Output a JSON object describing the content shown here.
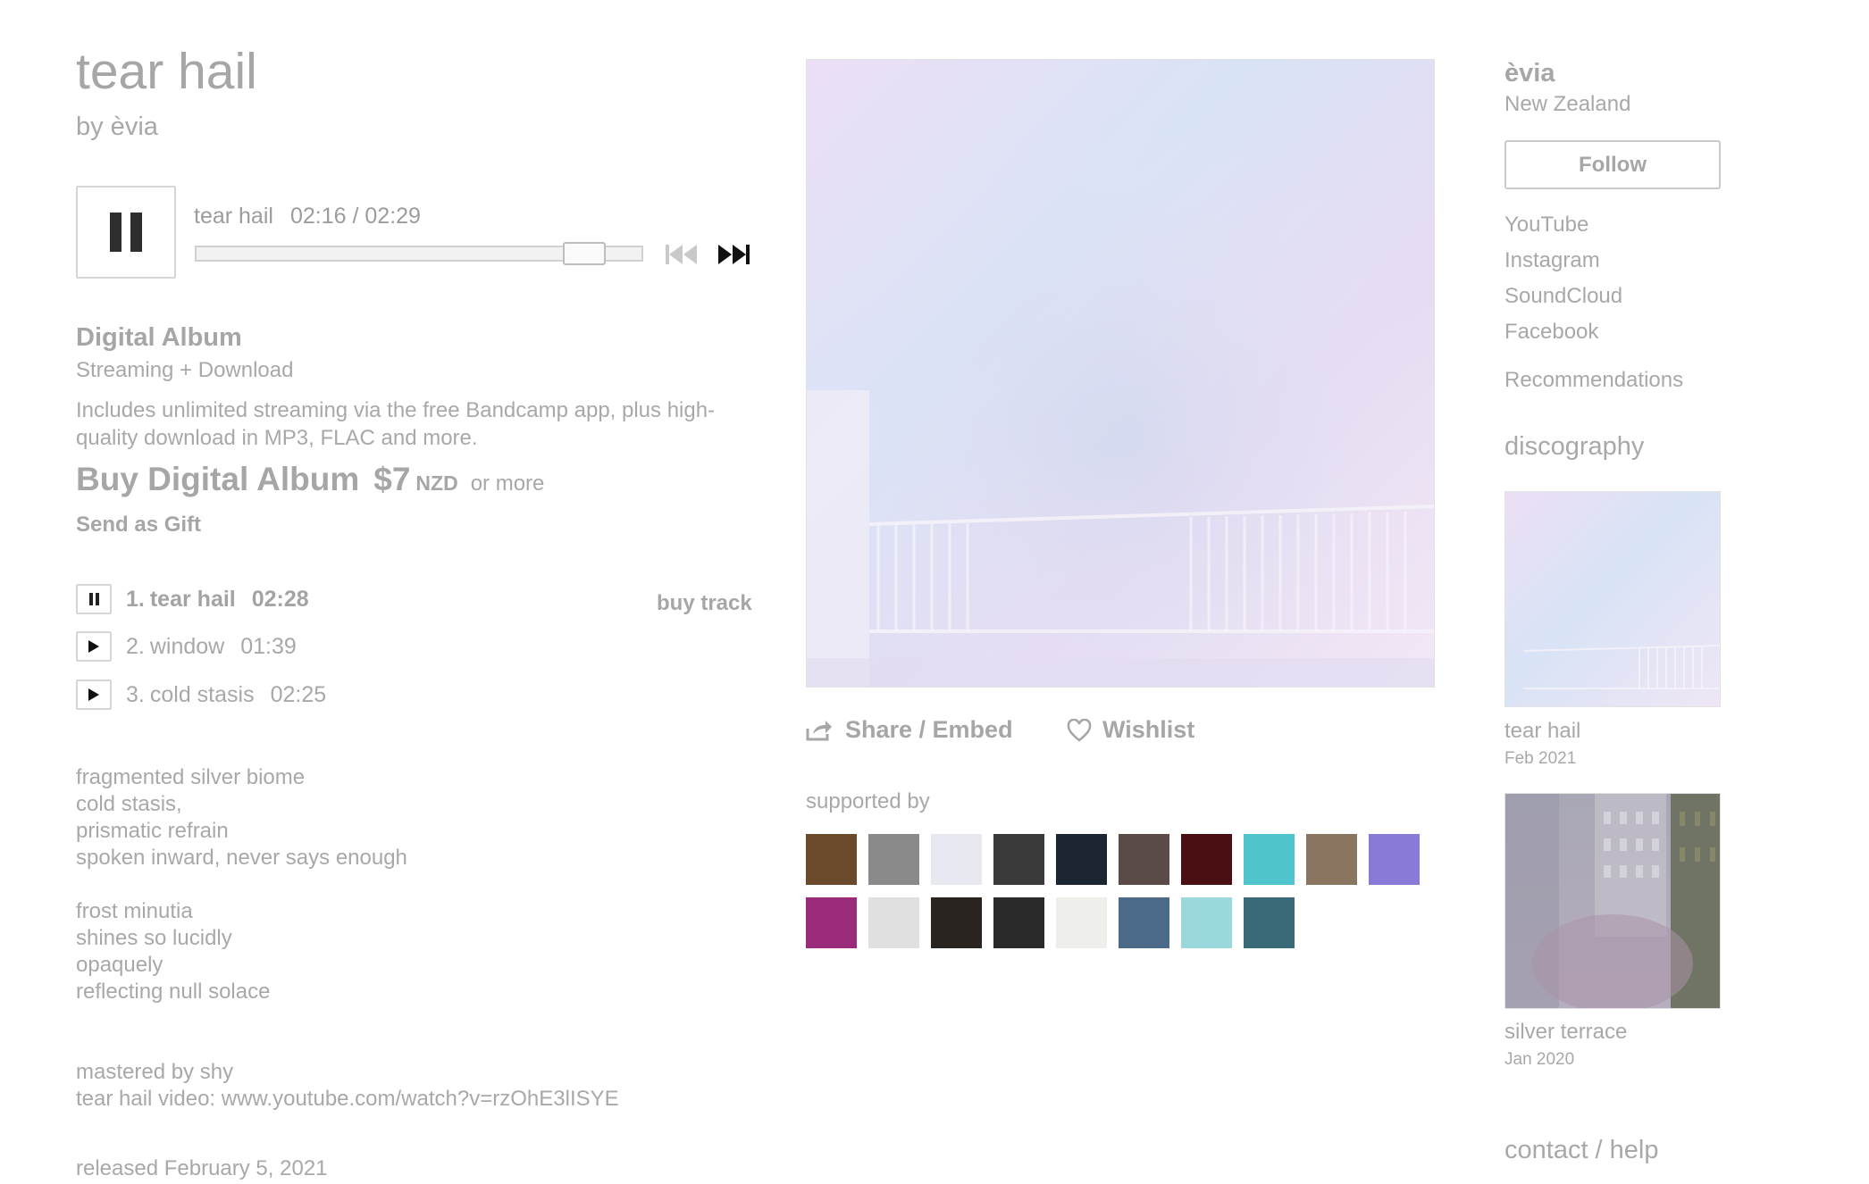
{
  "album": {
    "title": "tear hail",
    "by": "by èvia"
  },
  "player": {
    "track_title": "tear hail",
    "time": "02:16 / 02:29",
    "progress": 0.91
  },
  "purchase": {
    "format": "Digital Album",
    "streaming": "Streaming + Download",
    "description": "Includes unlimited streaming via the free Bandcamp app, plus high-quality download in MP3, FLAC and more.",
    "buy_label": "Buy Digital Album",
    "price": "$7",
    "currency": "NZD",
    "or_more": "or more",
    "gift": "Send as Gift"
  },
  "tracks": [
    {
      "number": "1.",
      "title": "tear hail",
      "duration": "02:28",
      "state": "playing"
    },
    {
      "number": "2.",
      "title": "window",
      "duration": "01:39",
      "state": "stopped"
    },
    {
      "number": "3.",
      "title": "cold stasis",
      "duration": "02:25",
      "state": "stopped"
    }
  ],
  "buy_track": "buy track",
  "lyrics": [
    "fragmented silver biome",
    "cold stasis,",
    "prismatic refrain",
    "spoken inward, never says enough",
    "frost minutia",
    "shines so lucidly",
    "opaquely",
    "reflecting null solace"
  ],
  "credits": {
    "mastered": "mastered by shy",
    "video": "tear hail video: www.youtube.com/watch?v=rzOhE3lISYE",
    "released": "released February 5, 2021"
  },
  "actions": {
    "share": "Share / Embed",
    "wishlist": "Wishlist"
  },
  "supported_by": {
    "label": "supported by",
    "fans": [
      {
        "color": "#6b4a2b"
      },
      {
        "color": "#8a8a8a"
      },
      {
        "color": "#e8e8f0"
      },
      {
        "color": "#3a3a3a"
      },
      {
        "color": "#1c2633"
      },
      {
        "color": "#5a4a48"
      },
      {
        "color": "#4a0f12"
      },
      {
        "color": "#4fc4cc"
      },
      {
        "color": "#8a7560"
      },
      {
        "color": "#8a7ad8"
      },
      {
        "color": "#9a2a7a"
      },
      {
        "color": "#e0e0e0"
      },
      {
        "color": "#2a2420"
      },
      {
        "color": "#2a2a2a"
      },
      {
        "color": "#eeeeea"
      },
      {
        "color": "#4a6a88"
      },
      {
        "color": "#9ad8dc"
      },
      {
        "color": "#3a6a78"
      }
    ]
  },
  "artist": {
    "name": "èvia",
    "location": "New Zealand",
    "follow": "Follow",
    "links": [
      "YouTube",
      "Instagram",
      "SoundCloud",
      "Facebook"
    ],
    "recommendations": "Recommendations"
  },
  "discography": {
    "heading": "discography",
    "items": [
      {
        "title": "tear hail",
        "date": "Feb 2021"
      },
      {
        "title": "silver terrace",
        "date": "Jan 2020"
      }
    ]
  },
  "footer": {
    "contact": "contact / help"
  },
  "icons": {
    "pause": "pause-icon",
    "play": "play-icon",
    "prev": "skip-previous-icon",
    "next": "skip-next-icon",
    "share": "share-icon",
    "wishlist": "heart-icon"
  }
}
